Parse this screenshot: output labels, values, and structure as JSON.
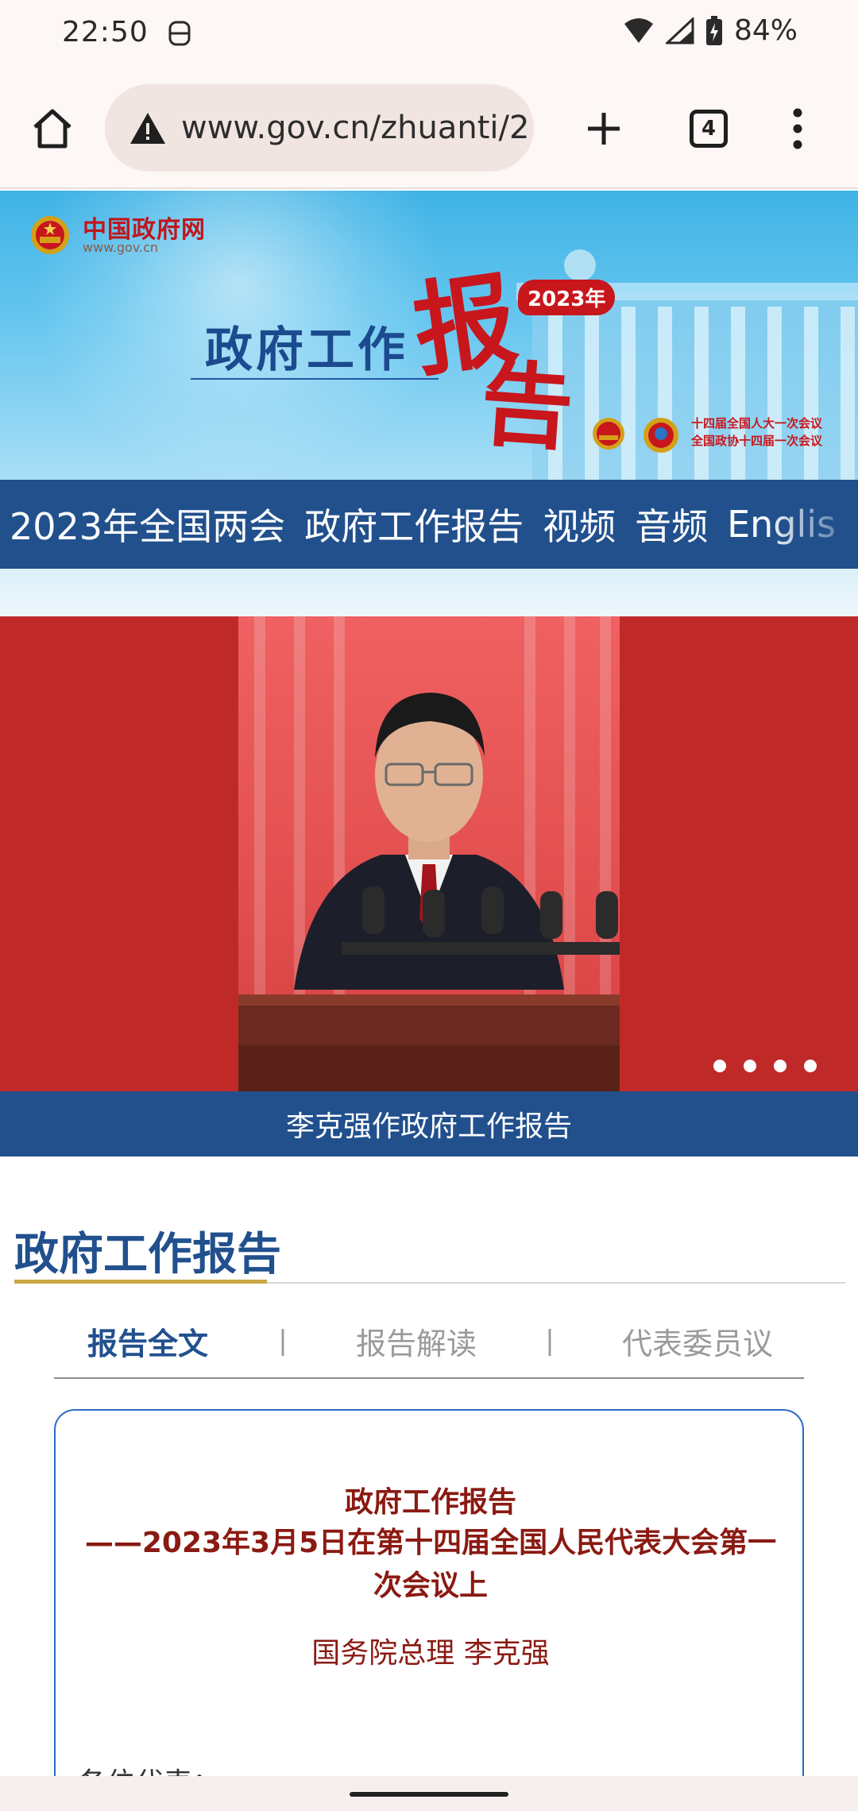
{
  "status_bar": {
    "time": "22:50",
    "battery": "84%"
  },
  "browser": {
    "url": "www.gov.cn/zhuanti/2",
    "tab_count": "4"
  },
  "banner": {
    "site_name": "中国政府网",
    "site_domain": "www.gov.cn",
    "title_part": "政府工作",
    "big_char_1": "报",
    "big_char_2": "告",
    "year_badge": "2023年",
    "meeting_line_1": "十四届全国人大一次会议",
    "meeting_line_2": "全国政协十四届一次会议"
  },
  "nav": {
    "items": [
      {
        "label": "2023年全国两会"
      },
      {
        "label": "政府工作报告"
      },
      {
        "label": "视频"
      },
      {
        "label": "音频"
      },
      {
        "label": "Englis"
      }
    ]
  },
  "carousel": {
    "caption": "李克强作政府工作报告",
    "slide_count": 4
  },
  "section": {
    "title": "政府工作报告",
    "tabs": [
      {
        "label": "报告全文",
        "active": true
      },
      {
        "label": "报告解读",
        "active": false
      },
      {
        "label": "代表委员议",
        "active": false
      }
    ],
    "separator": "|"
  },
  "card": {
    "title": "政府工作报告",
    "subtitle": "——2023年3月5日在第十四届全国人民代表大会第一次会议上",
    "author": "国务院总理 李克强",
    "greeting": "各位代表："
  },
  "colors": {
    "nav_blue": "#21508d",
    "accent_red": "#c8161d",
    "gold": "#c9a646"
  }
}
